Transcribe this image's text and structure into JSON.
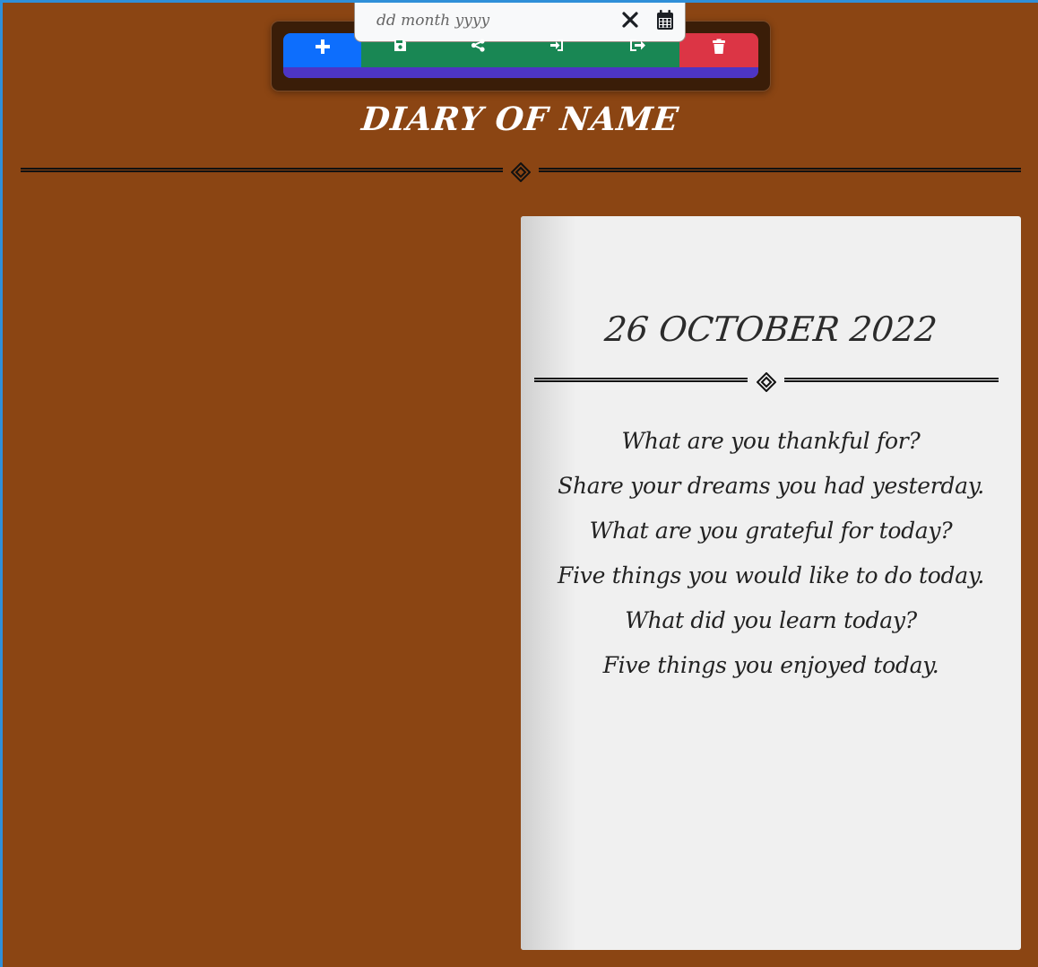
{
  "toolbar": {
    "buttons": [
      {
        "name": "add",
        "icon": "plus-icon",
        "color": "#0d6efd"
      },
      {
        "name": "save",
        "icon": "floppy-disk-icon",
        "color": "#198754"
      },
      {
        "name": "share",
        "icon": "share-nodes-icon",
        "color": "#198754"
      },
      {
        "name": "import",
        "icon": "sign-in-icon",
        "color": "#198754"
      },
      {
        "name": "export",
        "icon": "sign-out-icon",
        "color": "#198754"
      },
      {
        "name": "delete",
        "icon": "trash-icon",
        "color": "#dc3545"
      }
    ],
    "underline_color": "#4d35c4"
  },
  "date_picker": {
    "placeholder": "dd month yyyy",
    "clear_icon": "close-icon",
    "calendar_icon": "calendar-icon"
  },
  "diary": {
    "title": "DIARY OF NAME",
    "background_color": "#8b4513"
  },
  "page": {
    "date": "26 OCTOBER 2022",
    "prompts": [
      "What are you thankful for?",
      "Share your dreams you had yesterday.",
      "What are you grateful for today?",
      "Five things you would like to do today.",
      "What did you learn today?",
      "Five things you enjoyed today."
    ]
  }
}
